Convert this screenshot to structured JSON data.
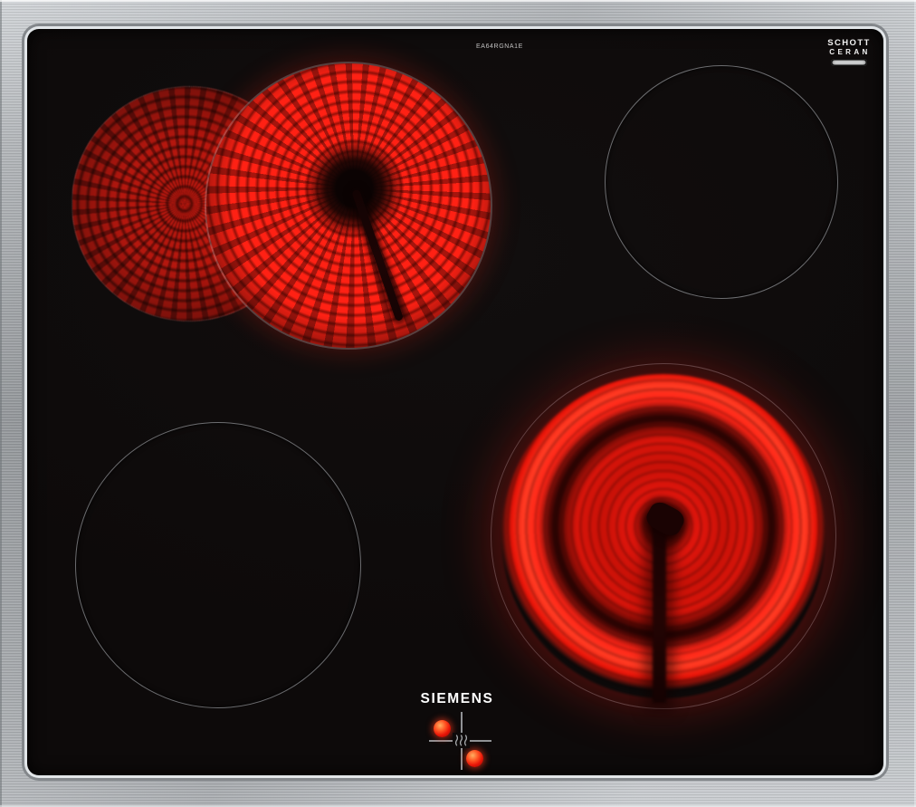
{
  "branding": {
    "siemens_logo": "SIEMENS",
    "model_code": "EA64RGNA1E",
    "schott_line1": "SCHOTT",
    "schott_line2": "CERAN"
  },
  "cooktop": {
    "type": "glass-ceramic hob",
    "frame": "brushed stainless steel",
    "zones": [
      {
        "position": "rear-left",
        "kind": "dual-extendable",
        "state": "on",
        "appearance": "bright red coil glow with extension segment"
      },
      {
        "position": "rear-right",
        "kind": "single",
        "state": "off",
        "appearance": "thin silver outline"
      },
      {
        "position": "front-left",
        "kind": "single",
        "state": "off",
        "appearance": "thin silver outline"
      },
      {
        "position": "front-right",
        "kind": "single",
        "state": "on",
        "appearance": "bright red radiant ring with dark sensor rod"
      }
    ],
    "residual_heat_indicator": {
      "symbol": "triple-wave",
      "active_dots": [
        "rear-left",
        "front-right"
      ]
    }
  },
  "colors": {
    "glass": "#0d0a0a",
    "steel_light": "#c9cdd1",
    "steel_dark": "#8e9296",
    "glow_bright": "#ff2416",
    "glow_mid": "#d8140a",
    "glow_dark": "#6b0a05",
    "outline_gray": "#b9bec3",
    "indicator_line": "#9ea1a4",
    "text_white": "#ffffff"
  }
}
